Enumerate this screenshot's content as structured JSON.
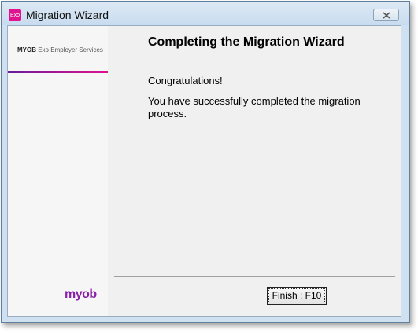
{
  "window": {
    "title": "Migration Wizard",
    "app_icon_label": "Exo"
  },
  "sidebar": {
    "brand_bold": "MYOB",
    "brand_rest": " Exo Employer Services",
    "logo_text": "myob"
  },
  "main": {
    "heading": "Completing the Migration Wizard",
    "congrats": "Congratulations!",
    "message": "You have successfully completed the migration process."
  },
  "buttons": {
    "finish_label": "Finish : F10"
  },
  "colors": {
    "brand_magenta": "#e0128e",
    "brand_purple": "#6a1b9a"
  },
  "icons": {
    "app": "exo-app-icon",
    "close": "close-icon"
  }
}
